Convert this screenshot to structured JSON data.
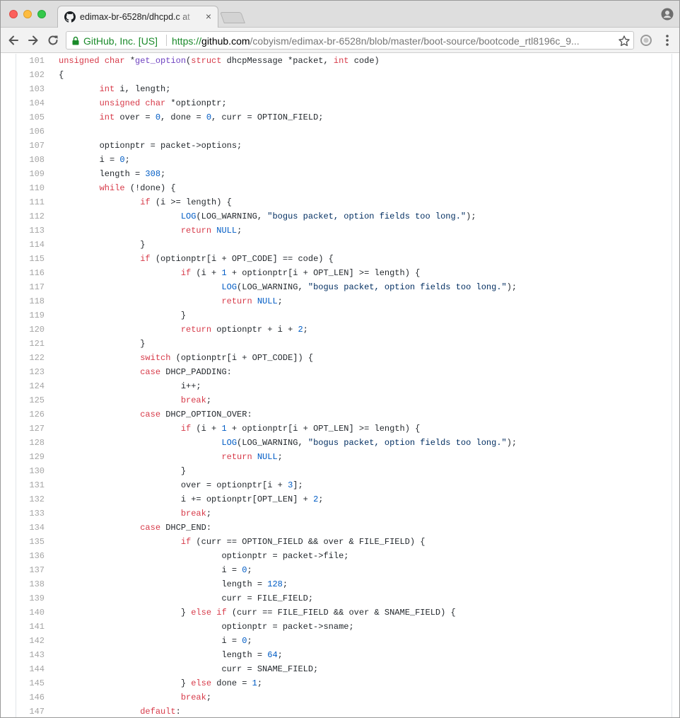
{
  "browser": {
    "tab_title": "edimax-br-6528n/dhcpd.c at",
    "tab_close": "×",
    "site_identity": "GitHub, Inc. [US]",
    "url_scheme": "https://",
    "url_host": "github.com",
    "url_path": "/cobyism/edimax-br-6528n/blob/master/boot-source/bootcode_rtl8196c_9..."
  },
  "icons": {
    "favicon": "github-icon",
    "back": "arrow-left-icon",
    "forward": "arrow-right-icon",
    "reload": "reload-icon",
    "lock": "lock-icon",
    "bookmark": "star-icon",
    "extension": "extension-icon",
    "menu": "kebab-menu-icon",
    "profile": "profile-icon"
  },
  "colors": {
    "keyword": "#d73a49",
    "function": "#6f42c1",
    "number": "#005cc5",
    "string": "#032f62",
    "text": "#24292e",
    "line_number": "#a5a5a5",
    "secure_green": "#1a8a2a"
  },
  "code": {
    "lines": [
      {
        "n": "101",
        "t": "unsigned char *get_option(struct dhcpMessage *packet, int code)"
      },
      {
        "n": "102",
        "t": "{"
      },
      {
        "n": "103",
        "t": "\tint i, length;"
      },
      {
        "n": "104",
        "t": "\tunsigned char *optionptr;"
      },
      {
        "n": "105",
        "t": "\tint over = 0, done = 0, curr = OPTION_FIELD;"
      },
      {
        "n": "106",
        "t": ""
      },
      {
        "n": "107",
        "t": "\toptionptr = packet->options;"
      },
      {
        "n": "108",
        "t": "\ti = 0;"
      },
      {
        "n": "109",
        "t": "\tlength = 308;"
      },
      {
        "n": "110",
        "t": "\twhile (!done) {"
      },
      {
        "n": "111",
        "t": "\t\tif (i >= length) {"
      },
      {
        "n": "112",
        "t": "\t\t\tLOG(LOG_WARNING, \"bogus packet, option fields too long.\");"
      },
      {
        "n": "113",
        "t": "\t\t\treturn NULL;"
      },
      {
        "n": "114",
        "t": "\t\t}"
      },
      {
        "n": "115",
        "t": "\t\tif (optionptr[i + OPT_CODE] == code) {"
      },
      {
        "n": "116",
        "t": "\t\t\tif (i + 1 + optionptr[i + OPT_LEN] >= length) {"
      },
      {
        "n": "117",
        "t": "\t\t\t\tLOG(LOG_WARNING, \"bogus packet, option fields too long.\");"
      },
      {
        "n": "118",
        "t": "\t\t\t\treturn NULL;"
      },
      {
        "n": "119",
        "t": "\t\t\t}"
      },
      {
        "n": "120",
        "t": "\t\t\treturn optionptr + i + 2;"
      },
      {
        "n": "121",
        "t": "\t\t}"
      },
      {
        "n": "122",
        "t": "\t\tswitch (optionptr[i + OPT_CODE]) {"
      },
      {
        "n": "123",
        "t": "\t\tcase DHCP_PADDING:"
      },
      {
        "n": "124",
        "t": "\t\t\ti++;"
      },
      {
        "n": "125",
        "t": "\t\t\tbreak;"
      },
      {
        "n": "126",
        "t": "\t\tcase DHCP_OPTION_OVER:"
      },
      {
        "n": "127",
        "t": "\t\t\tif (i + 1 + optionptr[i + OPT_LEN] >= length) {"
      },
      {
        "n": "128",
        "t": "\t\t\t\tLOG(LOG_WARNING, \"bogus packet, option fields too long.\");"
      },
      {
        "n": "129",
        "t": "\t\t\t\treturn NULL;"
      },
      {
        "n": "130",
        "t": "\t\t\t}"
      },
      {
        "n": "131",
        "t": "\t\t\tover = optionptr[i + 3];"
      },
      {
        "n": "132",
        "t": "\t\t\ti += optionptr[OPT_LEN] + 2;"
      },
      {
        "n": "133",
        "t": "\t\t\tbreak;"
      },
      {
        "n": "134",
        "t": "\t\tcase DHCP_END:"
      },
      {
        "n": "135",
        "t": "\t\t\tif (curr == OPTION_FIELD && over & FILE_FIELD) {"
      },
      {
        "n": "136",
        "t": "\t\t\t\toptionptr = packet->file;"
      },
      {
        "n": "137",
        "t": "\t\t\t\ti = 0;"
      },
      {
        "n": "138",
        "t": "\t\t\t\tlength = 128;"
      },
      {
        "n": "139",
        "t": "\t\t\t\tcurr = FILE_FIELD;"
      },
      {
        "n": "140",
        "t": "\t\t\t} else if (curr == FILE_FIELD && over & SNAME_FIELD) {"
      },
      {
        "n": "141",
        "t": "\t\t\t\toptionptr = packet->sname;"
      },
      {
        "n": "142",
        "t": "\t\t\t\ti = 0;"
      },
      {
        "n": "143",
        "t": "\t\t\t\tlength = 64;"
      },
      {
        "n": "144",
        "t": "\t\t\t\tcurr = SNAME_FIELD;"
      },
      {
        "n": "145",
        "t": "\t\t\t} else done = 1;"
      },
      {
        "n": "146",
        "t": "\t\t\tbreak;"
      },
      {
        "n": "147",
        "t": "\t\tdefault:"
      }
    ]
  }
}
